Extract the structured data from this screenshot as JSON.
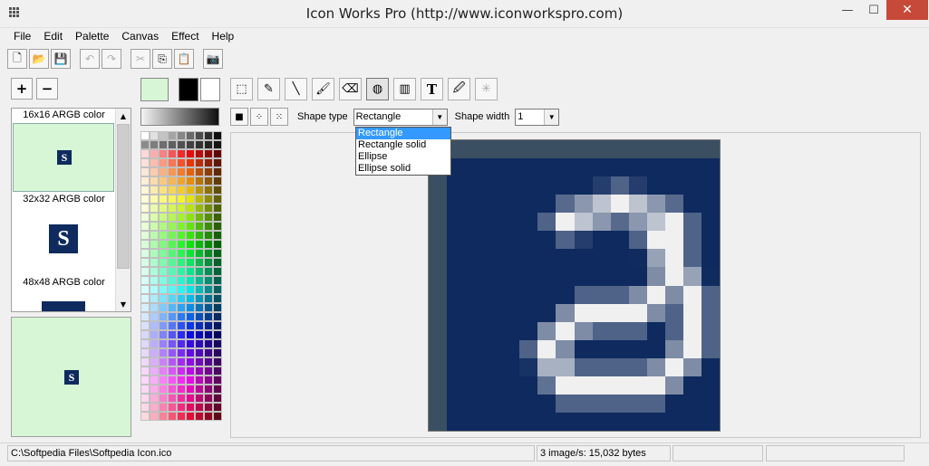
{
  "window": {
    "title": "Icon Works Pro (http://www.iconworkspro.com)",
    "min_glyph": "—",
    "max_glyph": "☐",
    "close_glyph": "✕"
  },
  "menu": [
    "File",
    "Edit",
    "Palette",
    "Canvas",
    "Effect",
    "Help"
  ],
  "toolbar": {
    "icons": [
      "new-file-icon",
      "open-folder-icon",
      "save-icon",
      "undo-icon",
      "redo-icon",
      "cut-icon",
      "copy-icon",
      "paste-icon",
      "capture-icon"
    ],
    "glyphs": {
      "new": "🗋",
      "open": "📂",
      "save": "💾",
      "undo": "↶",
      "redo": "↷",
      "cut": "✂",
      "copy": "⎘",
      "paste": "📋",
      "capture": "📷"
    }
  },
  "zoom": {
    "add": "+",
    "remove": "−"
  },
  "images": [
    {
      "label": "16x16 ARGB color",
      "glyph": "S"
    },
    {
      "label": "32x32 ARGB color",
      "glyph": "S"
    },
    {
      "label": "48x48 ARGB color",
      "glyph": "S"
    }
  ],
  "colors": {
    "primary": "#d7f6d6",
    "foreground": "#000000",
    "background": "#ffffff",
    "icon_bg": "#0e2a5e",
    "selection": "#3399ff"
  },
  "tools": {
    "icons": [
      "rectangle-select-icon",
      "pencil-icon",
      "line-icon",
      "brush-icon",
      "eraser-icon",
      "shape-icon",
      "fill-bucket-icon",
      "text-icon",
      "eyedropper-icon",
      "magic-wand-icon"
    ],
    "glyphs": [
      "⬚",
      "✎",
      "╲",
      "🖌",
      "⌫",
      "◍",
      "▥",
      "T",
      "🖉",
      "✳"
    ]
  },
  "shape_options": {
    "btn_glyphs": [
      "■",
      "⁘",
      "⁙"
    ],
    "shape_type_label": "Shape type",
    "shape_type_value": "Rectangle",
    "shape_width_label": "Shape width",
    "shape_width_value": "1",
    "dropdown_options": [
      "Rectangle",
      "Rectangle solid",
      "Ellipse",
      "Ellipse solid"
    ],
    "dropdown_arrow": "▼"
  },
  "status": {
    "path": "C:\\Softpedia Files\\Softpedia Icon.ico",
    "info": "3 image/s: 15,032 bytes"
  }
}
